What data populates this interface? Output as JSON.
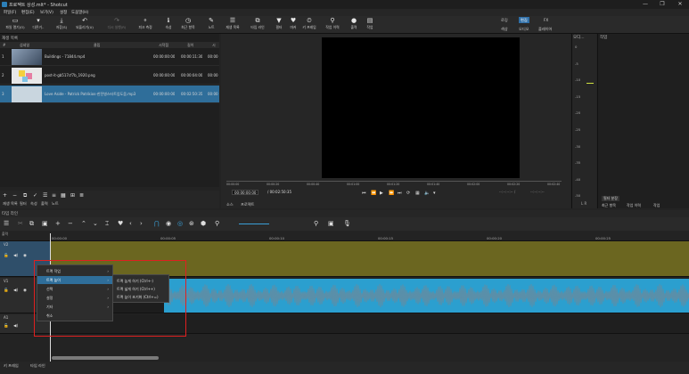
{
  "window": {
    "title": "프로젝트 상성.mlt* - Shotcut",
    "controls": [
      "—",
      "❐",
      "✕"
    ]
  },
  "menu": [
    "파일(F)",
    "편집(E)",
    "보기(V)",
    "설정",
    "도움말(H)"
  ],
  "toolbar": [
    {
      "icon": "▭",
      "label": "파일 열기(O)",
      "name": "open-file"
    },
    {
      "icon": "▾",
      "label": "다른거..",
      "name": "open-other"
    },
    {
      "icon": "⤓",
      "label": "저장(S)",
      "name": "save"
    },
    {
      "icon": "↶",
      "label": "되돌리기(U)",
      "name": "undo"
    },
    {
      "icon": "↷",
      "label": "다시 실행(R)",
      "name": "redo",
      "dim": true
    },
    {
      "icon": "⚬",
      "label": "피크 측정",
      "name": "peak-meter"
    },
    {
      "icon": "ℹ",
      "label": "속성",
      "name": "properties"
    },
    {
      "icon": "◷",
      "label": "최근 항목",
      "name": "recent"
    },
    {
      "icon": "✎",
      "label": "노트",
      "name": "notes"
    },
    {
      "icon": "☰",
      "label": "재생 목록",
      "name": "playlist"
    },
    {
      "icon": "⧉",
      "label": "타임 라인",
      "name": "timeline"
    },
    {
      "icon": "▼",
      "label": "필터",
      "name": "filters"
    },
    {
      "icon": "♥",
      "label": "마커",
      "name": "markers"
    },
    {
      "icon": "⏲",
      "label": "키 프레임",
      "name": "keyframes"
    },
    {
      "icon": "⚲",
      "label": "작업 이력",
      "name": "history"
    },
    {
      "icon": "●",
      "label": "출력",
      "name": "export"
    },
    {
      "icon": "▤",
      "label": "작업",
      "name": "jobs"
    }
  ],
  "layouts": {
    "row1": [
      "로깅",
      "편집",
      "FX"
    ],
    "row2": [
      "색상",
      "오디오",
      "플레이어"
    ],
    "active": "편집"
  },
  "playlist": {
    "title": "재생 목록",
    "columns": [
      "#",
      "섬네일",
      "클립",
      "시작점",
      "길이",
      "시"
    ],
    "rows": [
      {
        "num": "1",
        "clip": "Buildings - 71844.mp4",
        "start": "00:00:00:00",
        "dur": "00:00:11:30",
        "extra": "00:00"
      },
      {
        "num": "2",
        "clip": "post-it-gb517cf7b_1920.png",
        "start": "00:00:00:00",
        "dur": "00:00:04:00",
        "extra": "00:00"
      },
      {
        "num": "3",
        "clip": "Love Aside - Patrick Patrikios-한전병스타트업도움.mp3",
        "start": "00:00:00:00",
        "dur": "00:02:50:35",
        "extra": "00:00"
      }
    ],
    "tabs": [
      "재생 목록",
      "필터",
      "속성",
      "출력",
      "노트"
    ]
  },
  "viewer": {
    "ruler": [
      "00:00:00",
      "00:00:20",
      "00:00:40",
      "00:01:00",
      "00:01:20",
      "00:01:40",
      "00:02:00",
      "00:02:20",
      "00:02:40"
    ],
    "current": "00:00:00:00",
    "total": "/ 00:02:50:35",
    "in_out": "--:--:--:-- /",
    "in_out2": "--:--:--:--",
    "tabs": [
      "소스",
      "프로젝트"
    ]
  },
  "audio": {
    "title": "오디...",
    "ticks": [
      "0",
      "-5",
      "-10",
      "-15",
      "-20",
      "-25",
      "-30",
      "-35",
      "-40",
      "-50"
    ],
    "lr": "L R",
    "level": 0.36
  },
  "jobs": {
    "title": "작업",
    "bottom_tabs": [
      "필터 분장",
      "최근 항목",
      "작업 이력",
      "작업"
    ]
  },
  "timeline": {
    "title": "타임 라인",
    "ruler": [
      "00:00:00",
      "00:00:05",
      "00:00:10",
      "00:00:15",
      "00:00:20",
      "00:00:25"
    ],
    "output_label": "출력",
    "tracks": [
      {
        "name": "V2"
      },
      {
        "name": "V1"
      },
      {
        "name": "A1"
      }
    ]
  },
  "context_menu": {
    "items": [
      "트랙 작업",
      "트랙 높이",
      "선택",
      "설정",
      "기타",
      "취소"
    ],
    "highlighted": "트랙 높이",
    "submenu": [
      "트랙 높게 하기 (Ctrl+-)",
      "트랙 넓게 하기 (Ctrl++)",
      "트랙 높이 초기화 (Ctrl+=)"
    ]
  },
  "status_tabs": [
    "키 프레임",
    "타임 라인"
  ],
  "colors": {
    "v2_track": "#6b6620",
    "v1_track": "#2b9fcf",
    "highlight": "#2f6e9a",
    "annotation_box": "#e02020"
  }
}
